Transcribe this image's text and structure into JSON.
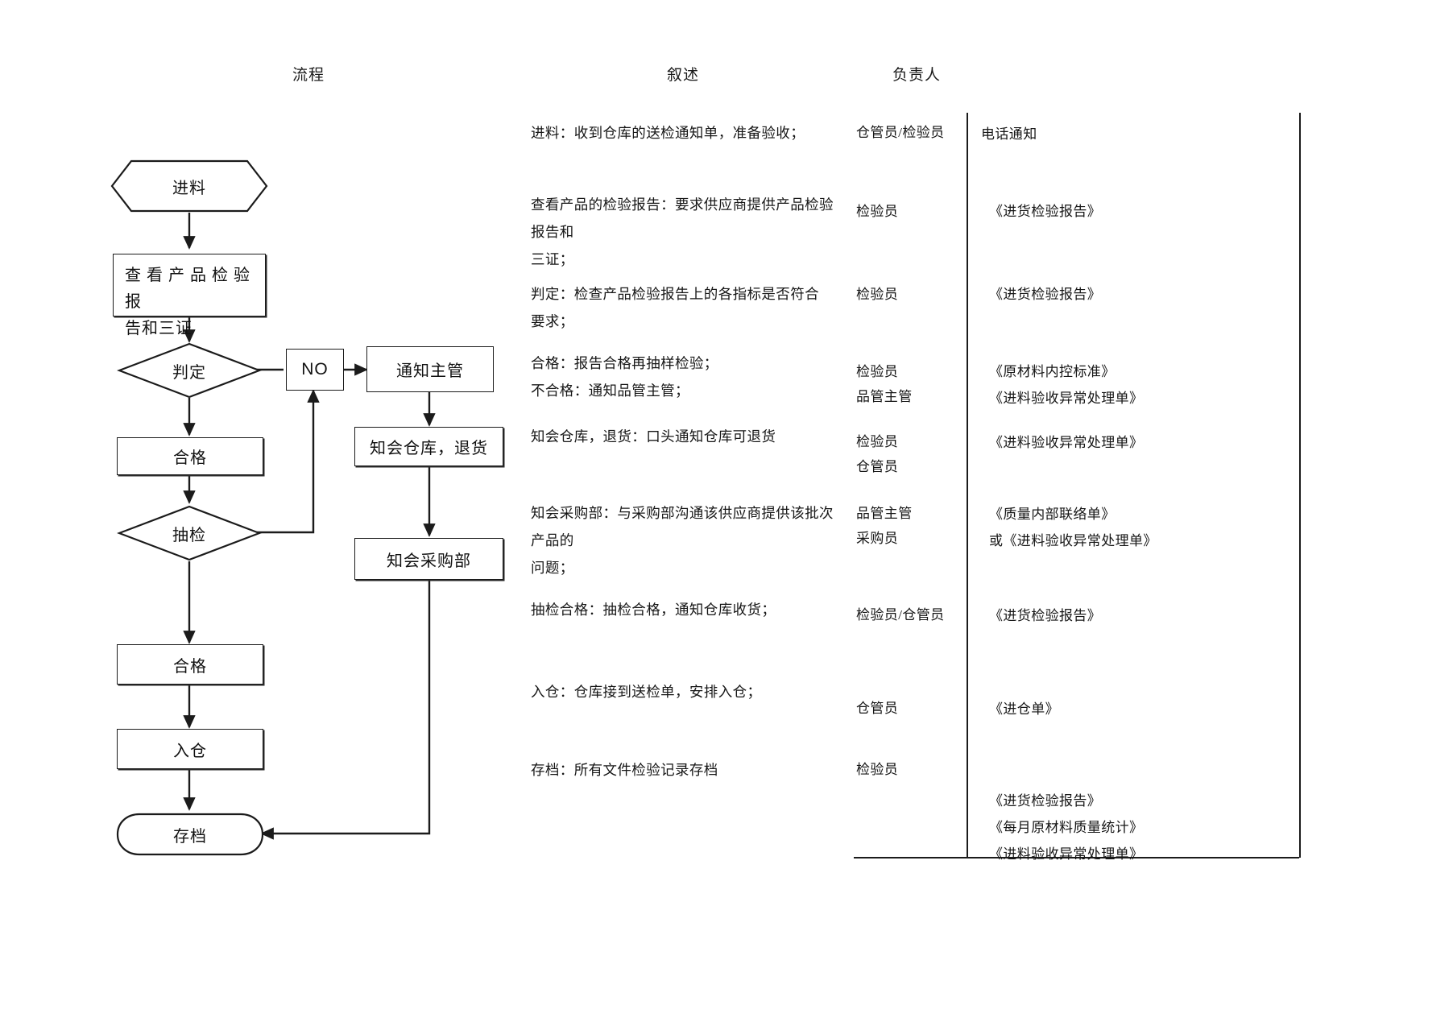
{
  "headers": {
    "flow": "流程",
    "description": "叙述",
    "owner": "负责人"
  },
  "flowchart": {
    "nodes": [
      {
        "id": "start",
        "shape": "hexagon",
        "label": "进料"
      },
      {
        "id": "check-report",
        "shape": "rect",
        "label": "查 看 产 品 检 验 报\n告和三证"
      },
      {
        "id": "judge",
        "shape": "diamond",
        "label": "判定"
      },
      {
        "id": "no",
        "shape": "rect-small",
        "label": "NO"
      },
      {
        "id": "notify-sup",
        "shape": "rect",
        "label": "通知主管"
      },
      {
        "id": "qualified-1",
        "shape": "rect",
        "label": "合格"
      },
      {
        "id": "inform-wh",
        "shape": "rect",
        "label": "知会仓库，退货"
      },
      {
        "id": "sampling",
        "shape": "diamond",
        "label": "抽检"
      },
      {
        "id": "inform-buy",
        "shape": "rect",
        "label": "知会采购部"
      },
      {
        "id": "qualified-2",
        "shape": "rect",
        "label": "合格"
      },
      {
        "id": "warehouse",
        "shape": "rect",
        "label": "入仓"
      },
      {
        "id": "archive",
        "shape": "terminator",
        "label": "存档"
      }
    ]
  },
  "rows": [
    {
      "description": "进料：收到仓库的送检通知单，准备验收；",
      "owner": "仓管员/检验员",
      "documents": "电话通知"
    },
    {
      "description": "查看产品的检验报告：要求供应商提供产品检验报告和\n三证；",
      "owner": "检验员",
      "documents": "《进货检验报告》"
    },
    {
      "description": "判定：检查产品检验报告上的各指标是否符合\n要求；",
      "owner": "检验员",
      "documents": "《进货检验报告》"
    },
    {
      "description": "合格：报告合格再抽样检验；\n不合格：通知品管主管；",
      "owner": "检验员\n品管主管",
      "documents": "《原材料内控标准》\n《进料验收异常处理单》"
    },
    {
      "description": "知会仓库，退货：口头通知仓库可退货",
      "owner": "检验员\n仓管员",
      "documents": "《进料验收异常处理单》"
    },
    {
      "description": "知会采购部：与采购部沟通该供应商提供该批次产品的\n问题；",
      "owner": "品管主管\n采购员",
      "documents": "《质量内部联络单》\n或《进料验收异常处理单》"
    },
    {
      "description": "抽检合格：抽检合格，通知仓库收货；",
      "owner": "检验员/仓管员",
      "documents": "《进货检验报告》"
    },
    {
      "description": "入仓：仓库接到送检单，安排入仓；",
      "owner": "仓管员",
      "documents": "《进仓单》"
    },
    {
      "description": "存档：所有文件检验记录存档",
      "owner": "检验员",
      "documents": "《进货检验报告》\n《每月原材料质量统计》\n《进料验收异常处理单》"
    }
  ],
  "colors": {
    "line": "#1b1b1b",
    "text": "#161616",
    "background": "#ffffff"
  }
}
